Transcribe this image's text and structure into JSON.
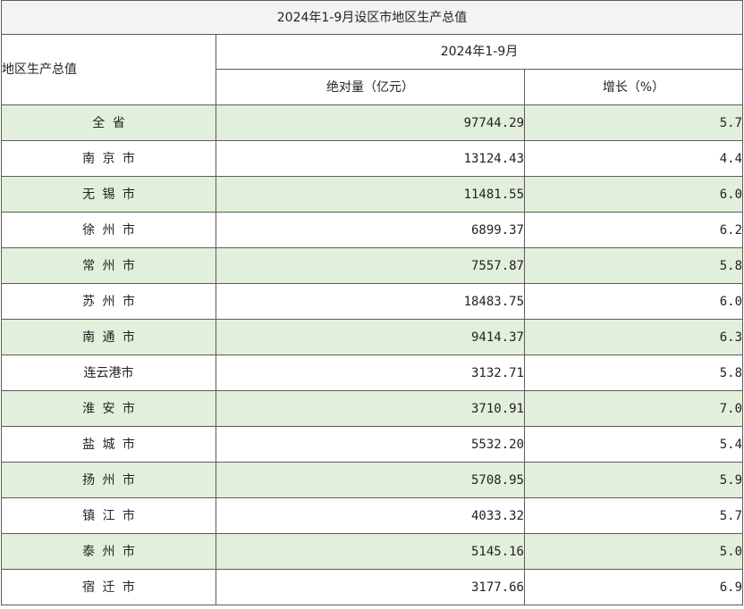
{
  "title": "2024年1-9月设区市地区生产总值",
  "header": {
    "region": "地区生产总值",
    "period": "2024年1-9月",
    "col_value": "绝对量（亿元）",
    "col_growth": "增长（%）"
  },
  "rows": [
    {
      "name": "全  省",
      "value": "97744.29",
      "growth": "5.7"
    },
    {
      "name": "南京市",
      "value": "13124.43",
      "growth": "4.4"
    },
    {
      "name": "无锡市",
      "value": "11481.55",
      "growth": "6.0"
    },
    {
      "name": "徐州市",
      "value": "6899.37",
      "growth": "6.2"
    },
    {
      "name": "常州市",
      "value": "7557.87",
      "growth": "5.8"
    },
    {
      "name": "苏州市",
      "value": "18483.75",
      "growth": "6.0"
    },
    {
      "name": "南通市",
      "value": "9414.37",
      "growth": "6.3"
    },
    {
      "name": "连云港市",
      "value": "3132.71",
      "growth": "5.8"
    },
    {
      "name": "淮安市",
      "value": "3710.91",
      "growth": "7.0"
    },
    {
      "name": "盐城市",
      "value": "5532.20",
      "growth": "5.4"
    },
    {
      "name": "扬州市",
      "value": "5708.95",
      "growth": "5.9"
    },
    {
      "name": "镇江市",
      "value": "4033.32",
      "growth": "5.7"
    },
    {
      "name": "泰州市",
      "value": "5145.16",
      "growth": "5.0"
    },
    {
      "name": "宿迁市",
      "value": "3177.66",
      "growth": "6.9"
    }
  ],
  "colors": {
    "shade": "#e2efda",
    "border": "#5c5c5c",
    "title_bg": "#f3f3f3"
  }
}
